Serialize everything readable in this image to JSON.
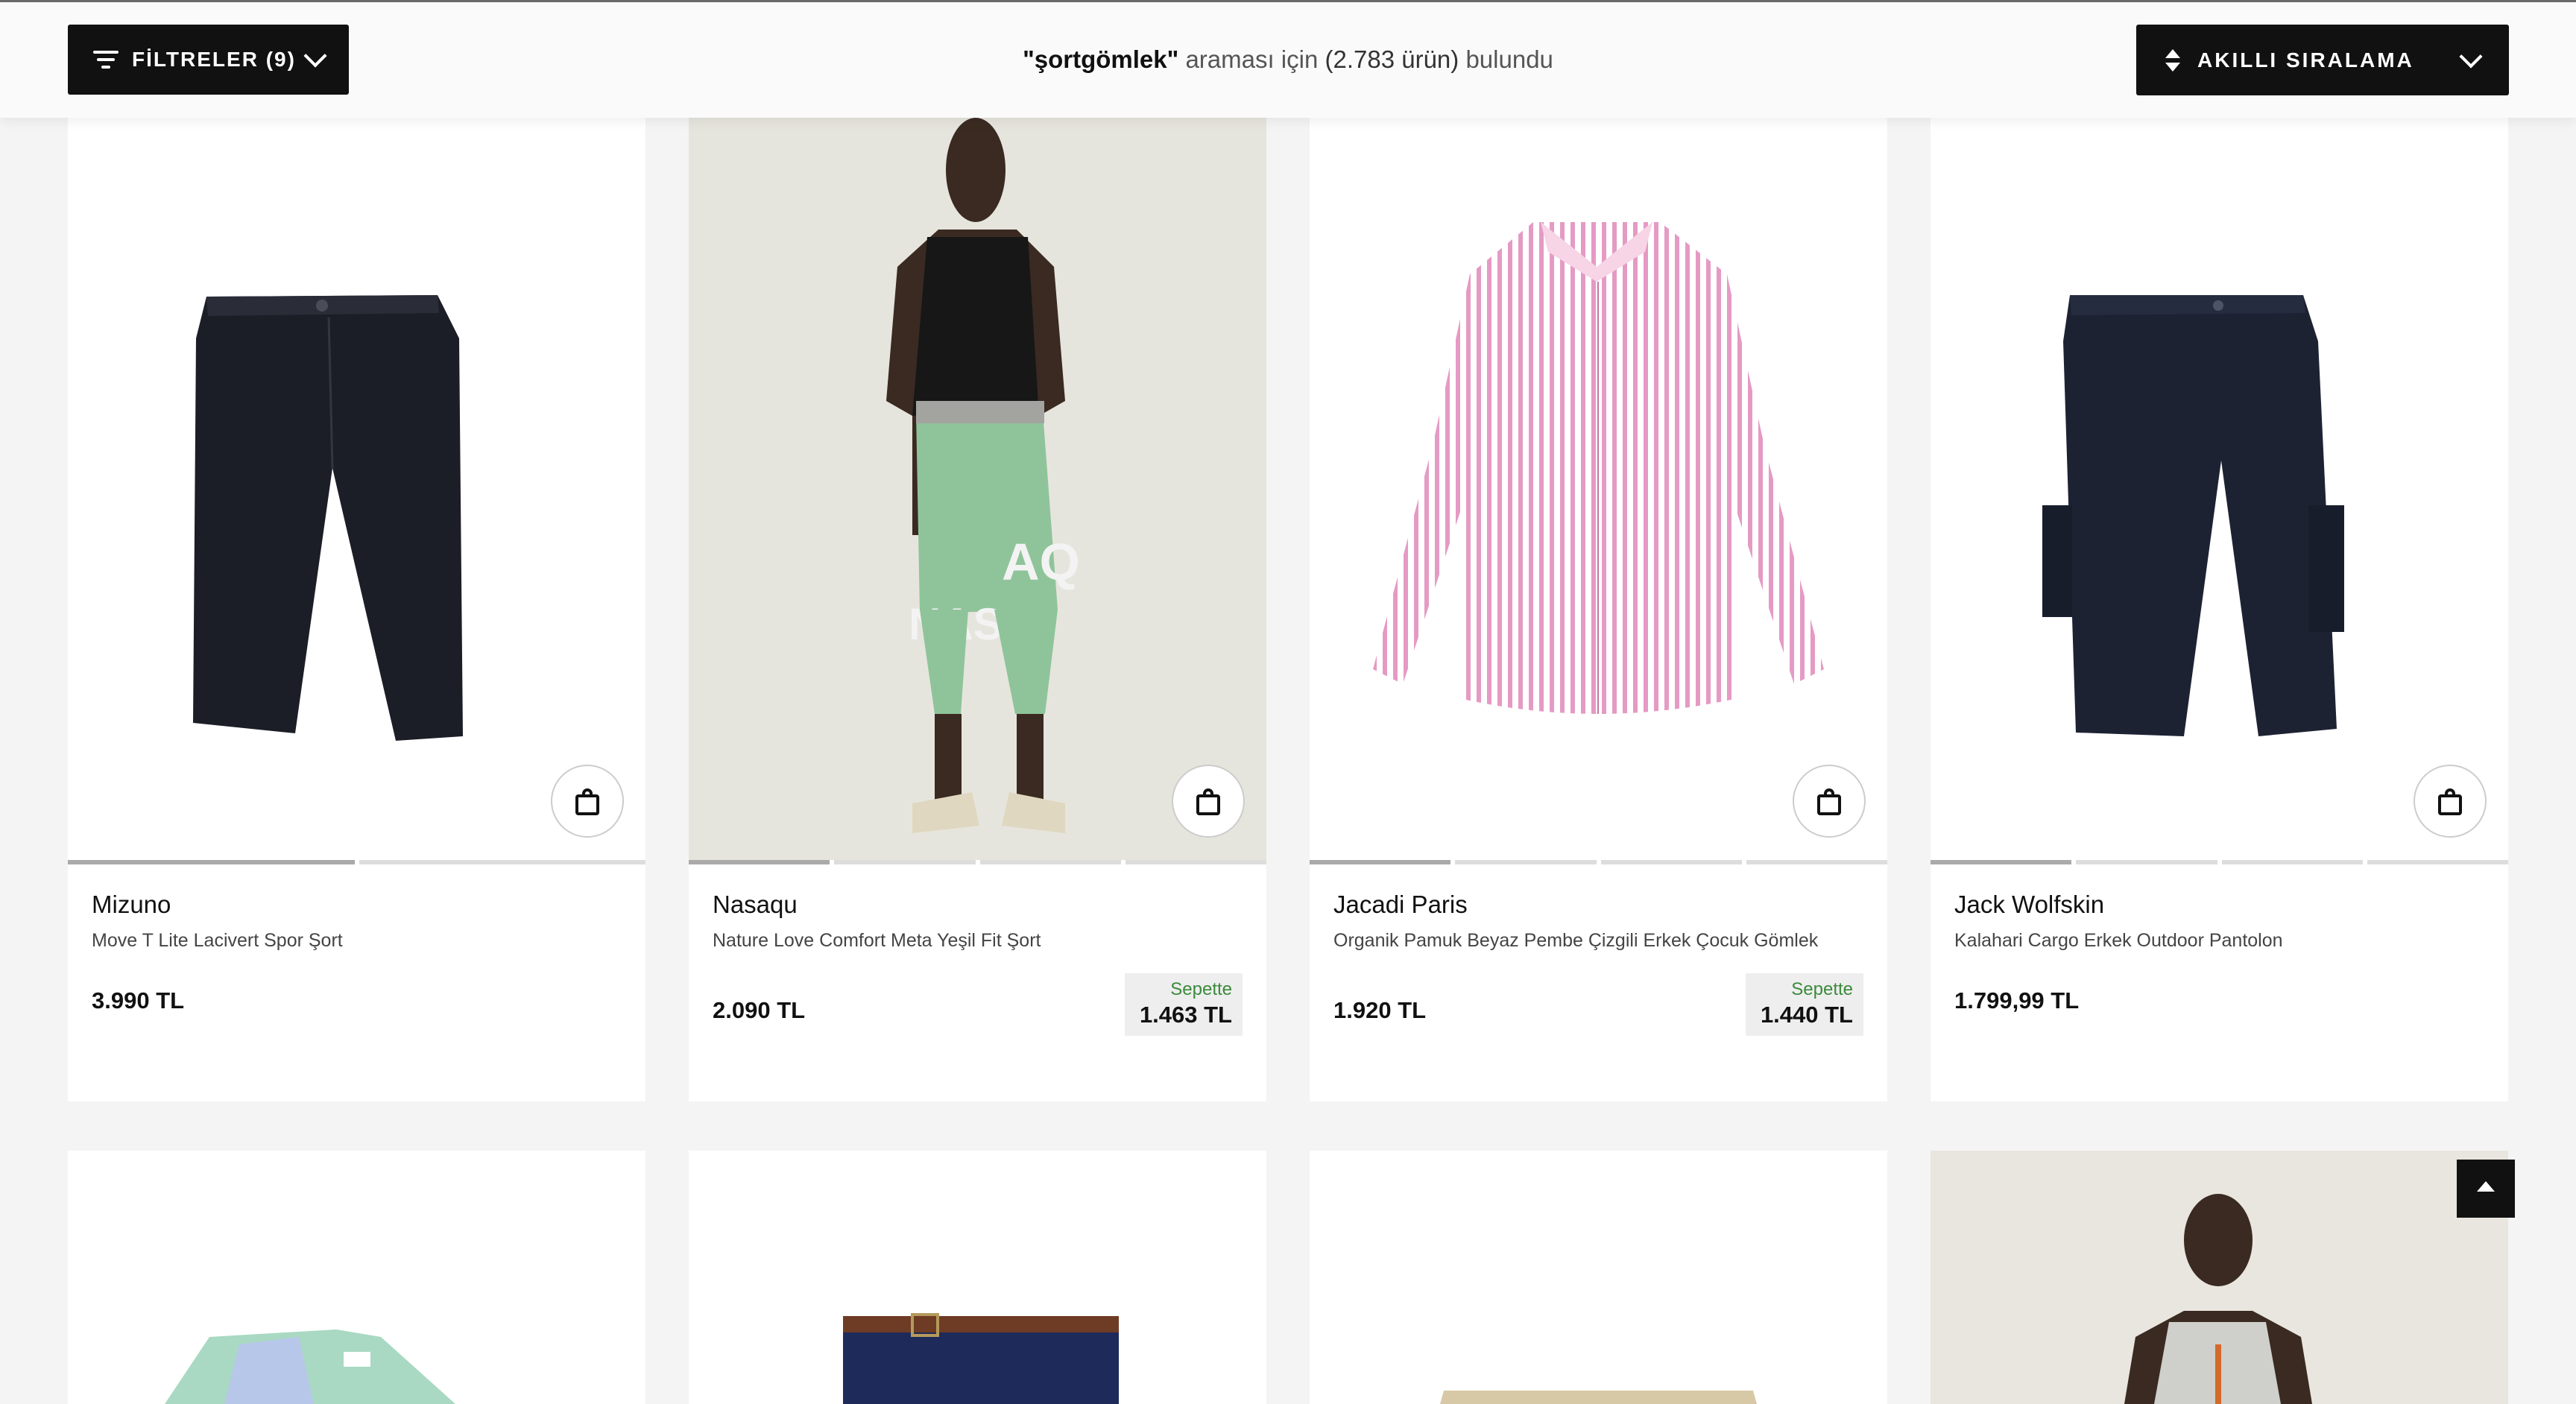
{
  "header": {
    "filter_label": "FİLTRELER (9)",
    "search_query": "\"şortgömlek\"",
    "result_pre": "araması için",
    "result_count": "(2.783 ürün)",
    "result_post": "bulundu",
    "sort_label": "AKILLI SIRALAMA"
  },
  "products": [
    {
      "brand": "Mizuno",
      "name": "Move T Lite Lacivert Spor Şort",
      "price": "3.990 TL",
      "cart_label": "",
      "cart_price": "",
      "image": "black-shorts"
    },
    {
      "brand": "Nasaqu",
      "name": "Nature Love Comfort Meta Yeşil Fit Şort",
      "price": "2.090 TL",
      "cart_label": "Sepette",
      "cart_price": "1.463 TL",
      "image": "model-green-shorts"
    },
    {
      "brand": "Jacadi Paris",
      "name": "Organik Pamuk Beyaz Pembe Çizgili Erkek Çocuk Gömlek",
      "price": "1.920 TL",
      "cart_label": "Sepette",
      "cart_price": "1.440 TL",
      "image": "pink-striped-shirt"
    },
    {
      "brand": "Jack Wolfskin",
      "name": "Kalahari Cargo Erkek Outdoor Pantolon",
      "price": "1.799,99 TL",
      "cart_label": "",
      "cart_price": "",
      "image": "navy-cargo-shorts"
    }
  ],
  "second_row": [
    {
      "image": "printed-shirt"
    },
    {
      "image": "navy-shorts-with-belt"
    },
    {
      "image": "beige-shorts"
    },
    {
      "image": "model-tank-top"
    }
  ],
  "icons": {
    "filter": "filter-lines-icon",
    "sort": "sort-arrows-icon",
    "bag": "shopping-bag-icon",
    "scroll_top": "arrow-up-icon"
  }
}
